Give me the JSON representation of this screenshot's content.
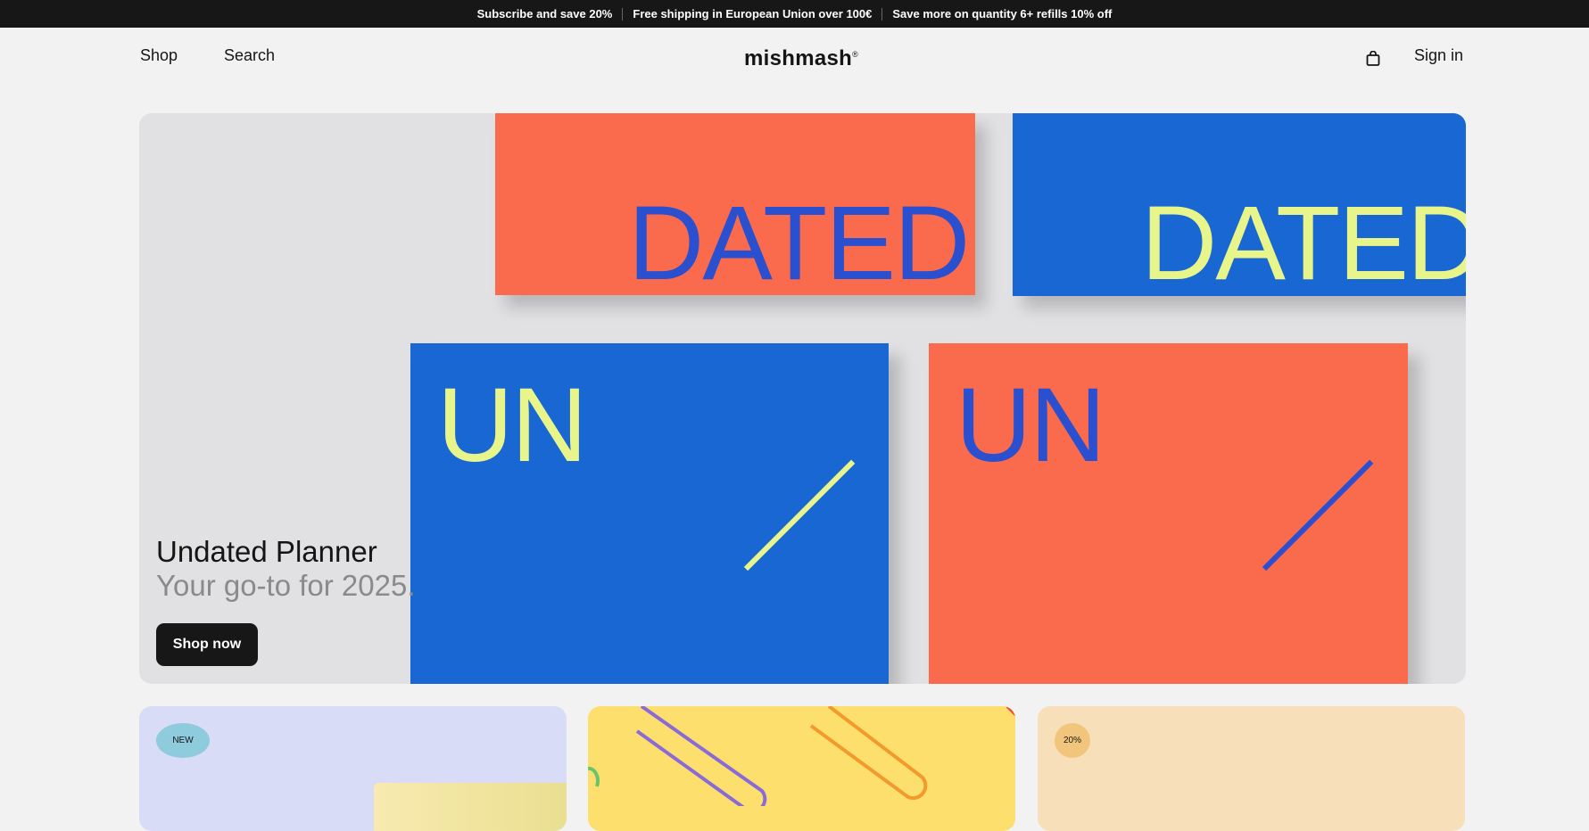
{
  "announcement": [
    "Subscribe and save 20%",
    "Free shipping in European Union over 100€",
    "Save more on quantity 6+ refills 10% off"
  ],
  "header": {
    "shop": "Shop",
    "search": "Search",
    "logo": "mishmash",
    "logo_mark": "®",
    "sign_in": "Sign in",
    "cart_icon": "shopping-bag-icon"
  },
  "hero": {
    "title": "Undated Planner",
    "subtitle": "Your go-to for 2025.",
    "cta": "Shop now",
    "image_text": {
      "dated": "DATED",
      "un": "UN"
    }
  },
  "cards": [
    {
      "badge": "NEW",
      "color": "#d8dcf7",
      "badge_color": "#8ecbdc"
    },
    {
      "badge": "",
      "color": "#fddf6e"
    },
    {
      "badge": "20%",
      "color": "#f7dfb9",
      "badge_color": "#f2c57c"
    }
  ],
  "colors": {
    "orange": "#f96b4c",
    "blue": "#1967d2",
    "lime": "#e8f58a"
  }
}
